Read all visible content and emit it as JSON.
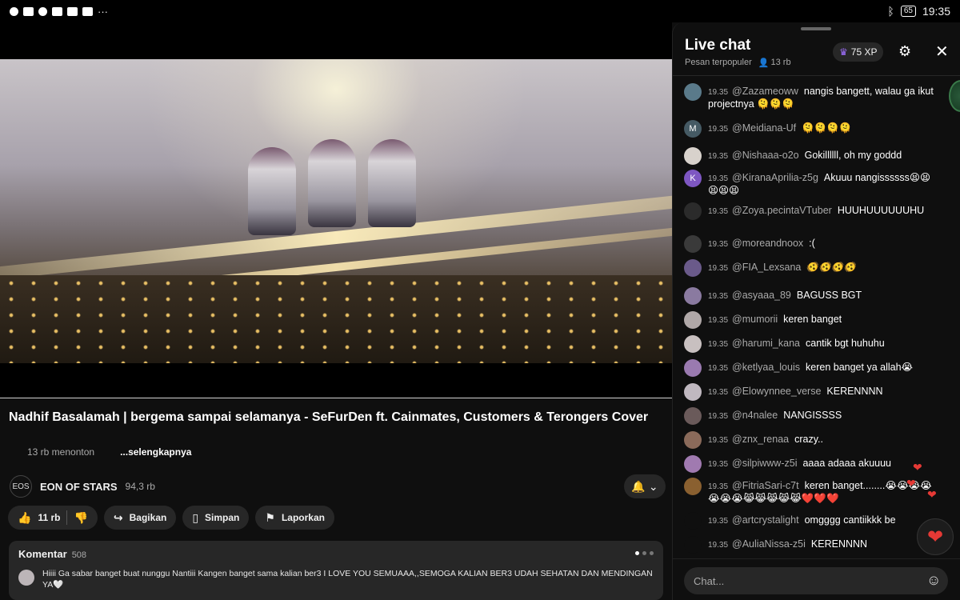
{
  "status_bar": {
    "time": "19:35",
    "battery": "65",
    "more": "···"
  },
  "video": {
    "title": "Nadhif Basalamah | bergema sampai selamanya - SeFurDen ft. Cainmates, Customers & Terongers Cover",
    "viewers": "13 rb menonton",
    "more_link": "...selengkapnya"
  },
  "channel": {
    "name": "EON OF STARS",
    "subscribers": "94,3 rb",
    "logo_text": "EOS"
  },
  "actions": {
    "like_count": "11 rb",
    "share": "Bagikan",
    "save": "Simpan",
    "report": "Laporkan"
  },
  "comments": {
    "label": "Komentar",
    "count": "508",
    "top_comment": "Hiiii Ga sabar banget buat nunggu Nantiii Kangen banget sama kalian ber3 I LOVE YOU SEMUAAA,,SEMOGA KALIAN BER3 UDAH SEHATAN DAN MENDINGAN YA🤍"
  },
  "live_chat": {
    "title": "Live chat",
    "mode": "Pesan terpopuler",
    "viewers": "13 rb",
    "xp": "75 XP",
    "input_placeholder": "Chat...",
    "messages": [
      {
        "time": "19.35",
        "user": "@Zazameoww",
        "text": "nangis bangett, walau ga ikut projectnya 🫠🫠🫠",
        "avatar": "",
        "color": "#5a7a8a"
      },
      {
        "time": "19.35",
        "user": "@Meidiana-Uf",
        "text": "🫠🫠🫠🫠",
        "avatar": "M",
        "color": "#455a64"
      },
      {
        "time": "19.35",
        "user": "@Nishaaa-o2o",
        "text": "Gokillllll, oh my goddd",
        "avatar": "",
        "color": "#d8d2cc"
      },
      {
        "time": "19.35",
        "user": "@KiranaAprilia-z5g",
        "text": "Akuuu nangissssss😫😫😫😫😫",
        "avatar": "K",
        "color": "#7e57c2"
      },
      {
        "time": "19.35",
        "user": "@Zoya.pecintaVTuber",
        "text": "HUUHUUUUUUHU",
        "avatar": "",
        "color": "#2b2b2b"
      },
      {
        "time": "19.35",
        "user": "@moreandnoox",
        "text": ":(",
        "avatar": "",
        "color": "#3a3a3a"
      },
      {
        "time": "19.35",
        "user": "@FIA_Lexsana",
        "text": "🫨🫨🫨🫨",
        "avatar": "",
        "color": "#6a5a8a"
      },
      {
        "time": "19.35",
        "user": "@asyaaa_89",
        "text": "BAGUSS BGT",
        "avatar": "",
        "color": "#8a7aa0"
      },
      {
        "time": "19.35",
        "user": "@mumorii",
        "text": "keren banget",
        "avatar": "",
        "color": "#b0a8a8"
      },
      {
        "time": "19.35",
        "user": "@harumi_kana",
        "text": "cantik bgt huhuhu",
        "avatar": "",
        "color": "#c8c0c0"
      },
      {
        "time": "19.35",
        "user": "@ketlyaa_louis",
        "text": "keren banget ya allah😭",
        "avatar": "",
        "color": "#9a7ab0"
      },
      {
        "time": "19.35",
        "user": "@Elowynnee_verse",
        "text": "KERENNNN",
        "avatar": "",
        "color": "#c0b8c0"
      },
      {
        "time": "19.35",
        "user": "@n4nalee",
        "text": "NANGISSSS",
        "avatar": "",
        "color": "#6a5a5a"
      },
      {
        "time": "19.35",
        "user": "@znx_renaa",
        "text": "crazy..",
        "avatar": "",
        "color": "#8a6a5a"
      },
      {
        "time": "19.35",
        "user": "@silpiwww-z5i",
        "text": "aaaa adaaa akuuuu",
        "avatar": "",
        "color": "#a07ab0"
      },
      {
        "time": "19.35",
        "user": "@FitriaSari-c7t",
        "text": "keren banget........😭😭😭😭😭😭😭😹😹😹😹😹❤️❤️❤️",
        "avatar": "",
        "color": "#8a6030"
      },
      {
        "time": "19.35",
        "user": "@artcrystalight",
        "text": "omgggg cantiikkk be",
        "avatar": "",
        "color": "#0f0f0f"
      },
      {
        "time": "19.35",
        "user": "@AuliaNissa-z5i",
        "text": "KERENNNN",
        "avatar": "",
        "color": "#0f0f0f"
      }
    ]
  },
  "colors": {
    "background": "#0f0f0f",
    "pill": "#272727",
    "accent_red": "#e53935",
    "xp_crown": "#a070ff"
  }
}
